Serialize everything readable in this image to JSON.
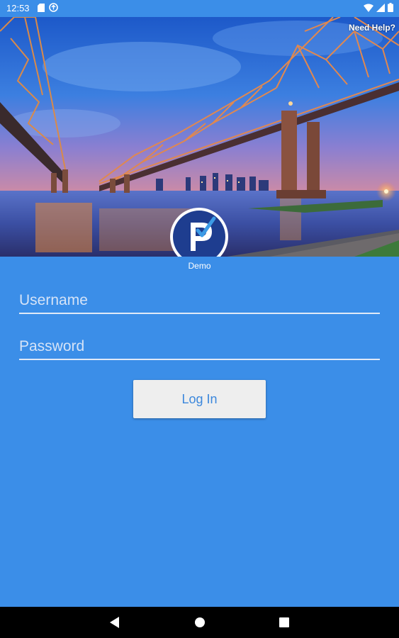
{
  "status_bar": {
    "time": "12:53",
    "left_icons": [
      "sd-card-icon",
      "sync-icon"
    ],
    "right_icons": [
      "wifi-icon",
      "signal-icon",
      "battery-icon"
    ]
  },
  "header": {
    "help_link": "Need Help?",
    "caption": "Demo",
    "logo_letter": "P"
  },
  "form": {
    "username_placeholder": "Username",
    "username_value": "",
    "password_placeholder": "Password",
    "password_value": "",
    "login_label": "Log In"
  },
  "nav_bar": {
    "buttons": [
      "back-icon",
      "home-icon",
      "recent-apps-icon"
    ]
  },
  "colors": {
    "background": "#3b8ee8",
    "button_bg": "#eeeeee",
    "button_text": "#3b87dc",
    "nav_bar": "#000000",
    "logo_ring": "#1e3d8f"
  }
}
